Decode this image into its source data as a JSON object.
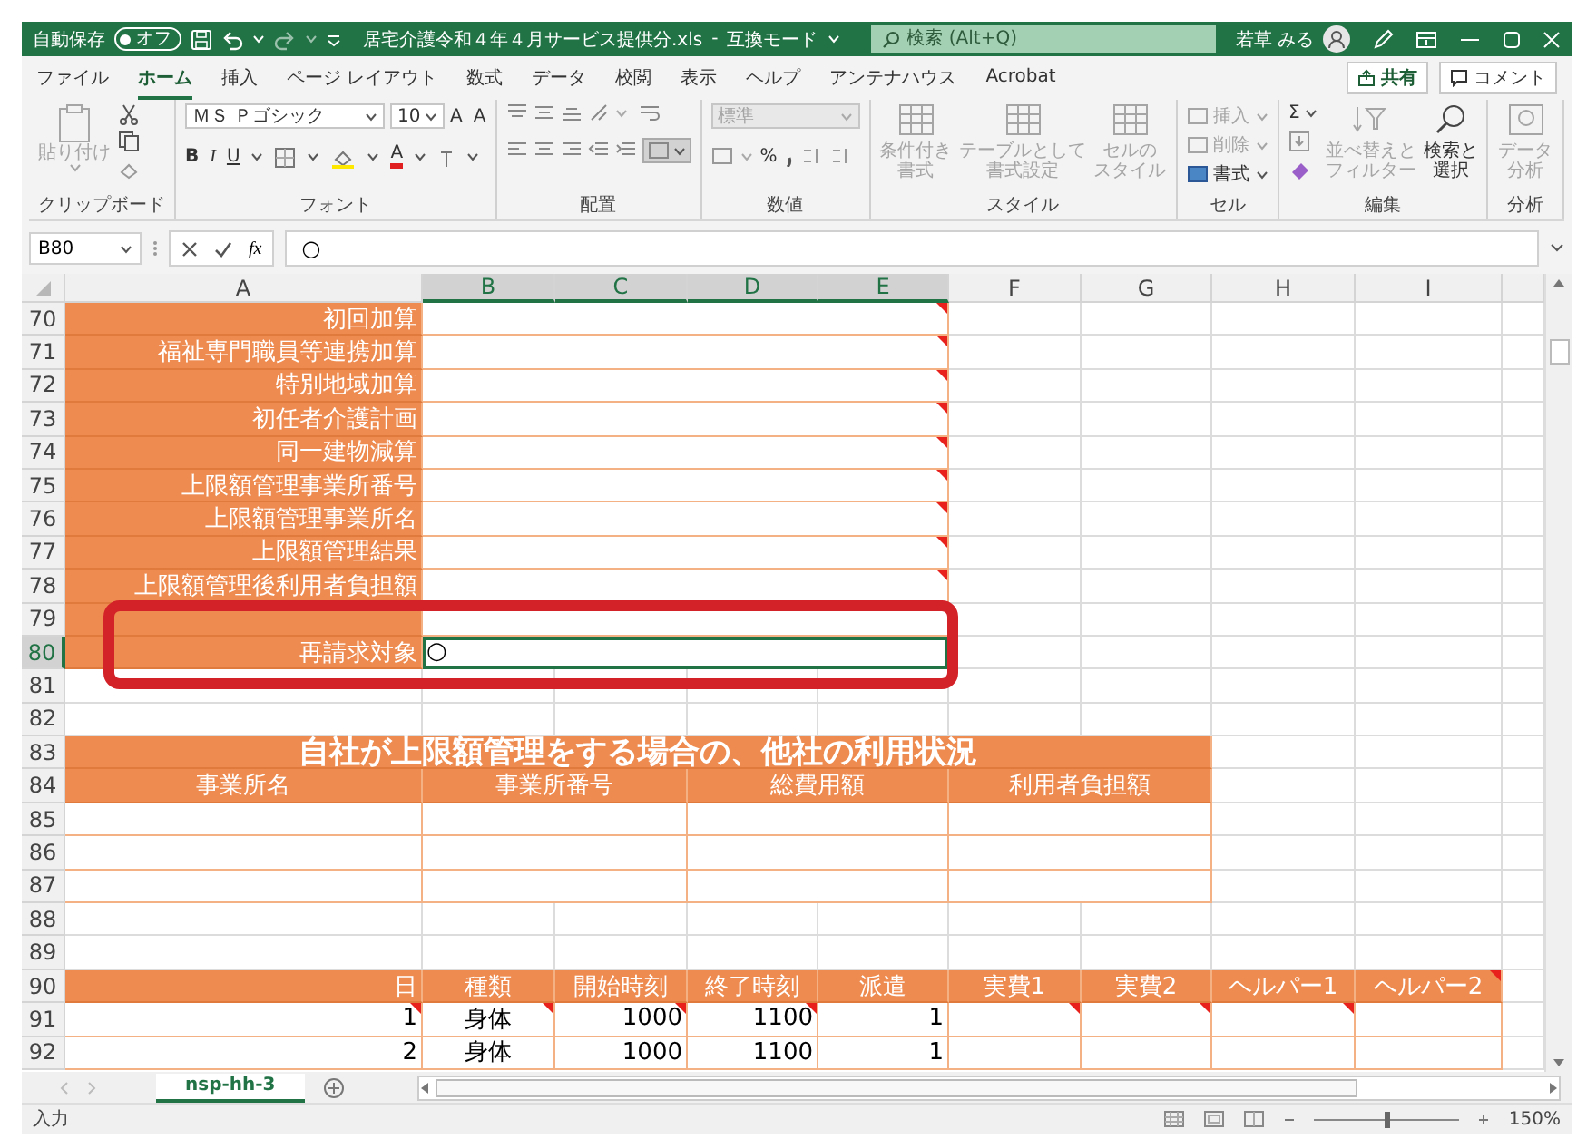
{
  "title_bar": {
    "autosave_label": "自動保存",
    "autosave_on": false,
    "autosave_state": "オフ",
    "document_title": "居宅介護令和４年４月サービス提供分.xls",
    "separator": "-",
    "mode": "互換モード",
    "search_placeholder": "検索 (Alt+Q)",
    "user_name": "若草 みる"
  },
  "menu_tabs": [
    {
      "label": "ファイル",
      "selected": false
    },
    {
      "label": "ホーム",
      "selected": true
    },
    {
      "label": "挿入",
      "selected": false
    },
    {
      "label": "ページ レイアウト",
      "selected": false
    },
    {
      "label": "数式",
      "selected": false
    },
    {
      "label": "データ",
      "selected": false
    },
    {
      "label": "校閲",
      "selected": false
    },
    {
      "label": "表示",
      "selected": false
    },
    {
      "label": "ヘルプ",
      "selected": false
    },
    {
      "label": "アンテナハウス",
      "selected": false
    },
    {
      "label": "Acrobat",
      "selected": false
    }
  ],
  "share_button": "共有",
  "comment_button": "コメント",
  "ribbon_groups": [
    {
      "kind": "clipboard",
      "label": "クリップボード",
      "paste": "貼り付け",
      "paste_disabled": true
    },
    {
      "kind": "font",
      "label": "フォント",
      "font_name": "ＭＳ Ｐゴシック",
      "font_size": "10",
      "grow": "A",
      "shrink": "A",
      "bold": "B",
      "italic": "I",
      "underline": "U",
      "font_color": "A"
    },
    {
      "kind": "alignment",
      "label": "配置"
    },
    {
      "kind": "number",
      "label": "数値",
      "format": "標準",
      "percent": "%"
    },
    {
      "kind": "styles",
      "label": "スタイル",
      "items": [
        {
          "lines": [
            "条件付き",
            "書式"
          ],
          "disabled": true
        },
        {
          "lines": [
            "テーブルとして",
            "書式設定"
          ],
          "disabled": true
        },
        {
          "lines": [
            "セルの",
            "スタイル"
          ],
          "disabled": true
        }
      ]
    },
    {
      "kind": "cells",
      "label": "セル",
      "items": [
        {
          "text": "挿入",
          "disabled": true
        },
        {
          "text": "削除",
          "disabled": true
        },
        {
          "text": "書式",
          "disabled": false
        }
      ]
    },
    {
      "kind": "editing",
      "label": "編集",
      "sum": "Σ",
      "items": [
        {
          "lines": [
            "並べ替えと",
            "フィルター"
          ],
          "disabled": true
        },
        {
          "lines": [
            "検索と",
            "選択"
          ],
          "disabled": false
        }
      ]
    },
    {
      "kind": "analysis",
      "label": "分析",
      "items": [
        {
          "lines": [
            "データ",
            "分析"
          ],
          "disabled": true
        }
      ]
    }
  ],
  "formula_bar": {
    "name_box": "B80",
    "function_symbol": "fx",
    "formula": "○"
  },
  "sheet": {
    "columns": [
      {
        "label": "A",
        "selected": false
      },
      {
        "label": "B",
        "selected": true
      },
      {
        "label": "C",
        "selected": true
      },
      {
        "label": "D",
        "selected": true
      },
      {
        "label": "E",
        "selected": true
      },
      {
        "label": "F",
        "selected": false
      },
      {
        "label": "G",
        "selected": false
      },
      {
        "label": "H",
        "selected": false
      },
      {
        "label": "I",
        "selected": false
      }
    ],
    "rows": [
      {
        "number": "70",
        "selected": false,
        "kind": "label",
        "cells": [
          {
            "text": "初回加算",
            "comment": false,
            "selected": false
          },
          {
            "comment": true,
            "selected": false
          }
        ]
      },
      {
        "number": "71",
        "selected": false,
        "kind": "label",
        "cells": [
          {
            "text": "福祉専門職員等連携加算",
            "comment": false,
            "selected": false
          },
          {
            "comment": true,
            "selected": false
          }
        ]
      },
      {
        "number": "72",
        "selected": false,
        "kind": "label",
        "cells": [
          {
            "text": "特別地域加算",
            "comment": false,
            "selected": false
          },
          {
            "comment": true,
            "selected": false
          }
        ]
      },
      {
        "number": "73",
        "selected": false,
        "kind": "label",
        "cells": [
          {
            "text": "初任者介護計画",
            "comment": false,
            "selected": false
          },
          {
            "comment": true,
            "selected": false
          }
        ]
      },
      {
        "number": "74",
        "selected": false,
        "kind": "label",
        "cells": [
          {
            "text": "同一建物減算",
            "comment": false,
            "selected": false
          },
          {
            "comment": true,
            "selected": false
          }
        ]
      },
      {
        "number": "75",
        "selected": false,
        "kind": "label",
        "cells": [
          {
            "text": "上限額管理事業所番号",
            "comment": false,
            "selected": false
          },
          {
            "comment": true,
            "selected": false
          }
        ]
      },
      {
        "number": "76",
        "selected": false,
        "kind": "label",
        "cells": [
          {
            "text": "上限額管理事業所名",
            "comment": false,
            "selected": false
          },
          {
            "comment": true,
            "selected": false
          }
        ]
      },
      {
        "number": "77",
        "selected": false,
        "kind": "label",
        "cells": [
          {
            "text": "上限額管理結果",
            "comment": false,
            "selected": false
          },
          {
            "comment": true,
            "selected": false
          }
        ]
      },
      {
        "number": "78",
        "selected": false,
        "kind": "label",
        "cells": [
          {
            "text": "上限額管理後利用者負担額",
            "comment": false,
            "selected": false
          },
          {
            "comment": true,
            "selected": false
          }
        ]
      },
      {
        "number": "79",
        "selected": false,
        "kind": "label",
        "cells": [
          {
            "comment": false,
            "selected": false
          },
          {
            "comment": false,
            "selected": false
          }
        ]
      },
      {
        "number": "80",
        "selected": true,
        "kind": "label",
        "cells": [
          {
            "text": "再請求対象",
            "comment": false,
            "selected": false
          },
          {
            "text": "○",
            "comment": false,
            "selected": true
          }
        ]
      },
      {
        "number": "81",
        "selected": false,
        "kind": "blank"
      },
      {
        "number": "82",
        "selected": false,
        "kind": "blank"
      },
      {
        "number": "83",
        "selected": false,
        "kind": "table_title",
        "cells": [
          {
            "text": "自社が上限額管理をする場合の、他社の利用状況",
            "comment": false,
            "selected": false
          }
        ]
      },
      {
        "number": "84",
        "selected": false,
        "kind": "table_header",
        "cells": [
          {
            "text": "事業所名",
            "comment": false,
            "selected": false
          },
          {
            "text": "事業所番号",
            "comment": false,
            "selected": false
          },
          {
            "text": "総費用額",
            "comment": false,
            "selected": false
          },
          {
            "text": "利用者負担額",
            "comment": false,
            "selected": false
          }
        ]
      },
      {
        "number": "85",
        "selected": false,
        "kind": "table_blank",
        "cells": [
          {
            "comment": false,
            "selected": false
          },
          {
            "comment": false,
            "selected": false
          },
          {
            "comment": false,
            "selected": false
          },
          {
            "comment": false,
            "selected": false
          }
        ]
      },
      {
        "number": "86",
        "selected": false,
        "kind": "table_blank",
        "cells": [
          {
            "comment": false,
            "selected": false
          },
          {
            "comment": false,
            "selected": false
          },
          {
            "comment": false,
            "selected": false
          },
          {
            "comment": false,
            "selected": false
          }
        ]
      },
      {
        "number": "87",
        "selected": false,
        "kind": "table_blank",
        "cells": [
          {
            "comment": false,
            "selected": false
          },
          {
            "comment": false,
            "selected": false
          },
          {
            "comment": false,
            "selected": false
          },
          {
            "comment": false,
            "selected": false
          }
        ]
      },
      {
        "number": "88",
        "selected": false,
        "kind": "blank"
      },
      {
        "number": "89",
        "selected": false,
        "kind": "blank"
      },
      {
        "number": "90",
        "selected": false,
        "kind": "data_header",
        "cells": [
          {
            "text": "日",
            "comment": false,
            "selected": false
          },
          {
            "text": "種類",
            "comment": false,
            "selected": false
          },
          {
            "text": "開始時刻",
            "comment": false,
            "selected": false
          },
          {
            "text": "終了時刻",
            "comment": false,
            "selected": false
          },
          {
            "text": "派遣",
            "comment": false,
            "selected": false
          },
          {
            "text": "実費1",
            "comment": false,
            "selected": false
          },
          {
            "text": "実費2",
            "comment": false,
            "selected": false
          },
          {
            "text": "ヘルパー1",
            "comment": false,
            "selected": false
          },
          {
            "text": "ヘルパー2",
            "comment": true,
            "selected": false
          }
        ]
      },
      {
        "number": "91",
        "selected": false,
        "kind": "data",
        "cells": [
          {
            "text": "1",
            "comment": true,
            "selected": false
          },
          {
            "text": "身体",
            "comment": true,
            "selected": false
          },
          {
            "text": "1000",
            "comment": true,
            "selected": false
          },
          {
            "text": "1100",
            "comment": true,
            "selected": false
          },
          {
            "text": "1",
            "comment": false,
            "selected": false
          },
          {
            "comment": true,
            "selected": false
          },
          {
            "comment": true,
            "selected": false
          },
          {
            "comment": true,
            "selected": false
          },
          {
            "comment": false,
            "selected": false
          }
        ]
      },
      {
        "number": "92",
        "selected": false,
        "kind": "data",
        "cells": [
          {
            "text": "2",
            "comment": false,
            "selected": false
          },
          {
            "text": "身体",
            "comment": false,
            "selected": false
          },
          {
            "text": "1000",
            "comment": false,
            "selected": false
          },
          {
            "text": "1100",
            "comment": false,
            "selected": false
          },
          {
            "text": "1",
            "comment": false,
            "selected": false
          },
          {
            "comment": false,
            "selected": false
          },
          {
            "comment": false,
            "selected": false
          },
          {
            "comment": false,
            "selected": false
          },
          {
            "comment": false,
            "selected": false
          }
        ]
      }
    ],
    "annotation": {
      "kind": "frame"
    }
  },
  "sheet_tabs": [
    {
      "label": "nsp-hh-3",
      "selected": true
    }
  ],
  "status_bar": {
    "mode": "入力",
    "zoom_slider": {
      "level": 0.5
    },
    "zoom": "150%"
  }
}
